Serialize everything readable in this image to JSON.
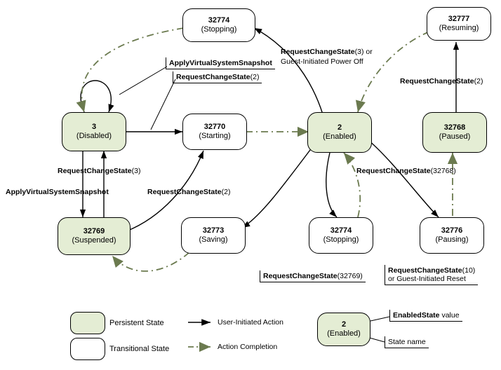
{
  "states": {
    "stopping1": {
      "id": "32774",
      "name": "(Stopping)"
    },
    "resuming": {
      "id": "32777",
      "name": "(Resuming)"
    },
    "disabled": {
      "id": "3",
      "name": "(Disabled)"
    },
    "starting": {
      "id": "32770",
      "name": "(Starting)"
    },
    "enabled": {
      "id": "2",
      "name": "(Enabled)"
    },
    "paused": {
      "id": "32768",
      "name": "(Paused)"
    },
    "suspended": {
      "id": "32769",
      "name": "(Suspended)"
    },
    "saving": {
      "id": "32773",
      "name": "(Saving)"
    },
    "stopping2": {
      "id": "32774",
      "name": "(Stopping)"
    },
    "pausing": {
      "id": "32776",
      "name": "(Pausing)"
    }
  },
  "labels": {
    "applySnap1": "ApplyVirtualSystemSnapshot",
    "rcs2_a": "RequestChangeState",
    "rcs2_a_arg": "(2)",
    "rcs3_or": "RequestChangeState",
    "rcs3_or_arg": "(3) or",
    "guestPoweroff": "Guest-Initiated Power Off",
    "rcs2_b": "RequestChangeState",
    "rcs2_b_arg": "(2)",
    "rcs3": "RequestChangeState",
    "rcs3_arg": "(3)",
    "applySnap2": "ApplyVirtualSystemSnapshot",
    "rcs2_c": "RequestChangeState",
    "rcs2_c_arg": "(2)",
    "rcs32768": "RequestChangeState",
    "rcs32768_arg": "(32768)",
    "rcs32769": "RequestChangeState",
    "rcs32769_arg": "(32769)",
    "rcs10": "RequestChangeState",
    "rcs10_arg": "(10)",
    "guestReset": "or Guest-Initiated Reset"
  },
  "legend": {
    "persistent": "Persistent State",
    "transitional": "Transitional State",
    "userAction": "User-Initiated Action",
    "actionCompletion": "Action Completion",
    "enabledValue": "EnabledState",
    "enabledValueSuffix": " value",
    "stateName": "State name",
    "sampleId": "2",
    "sampleName": "(Enabled)"
  }
}
